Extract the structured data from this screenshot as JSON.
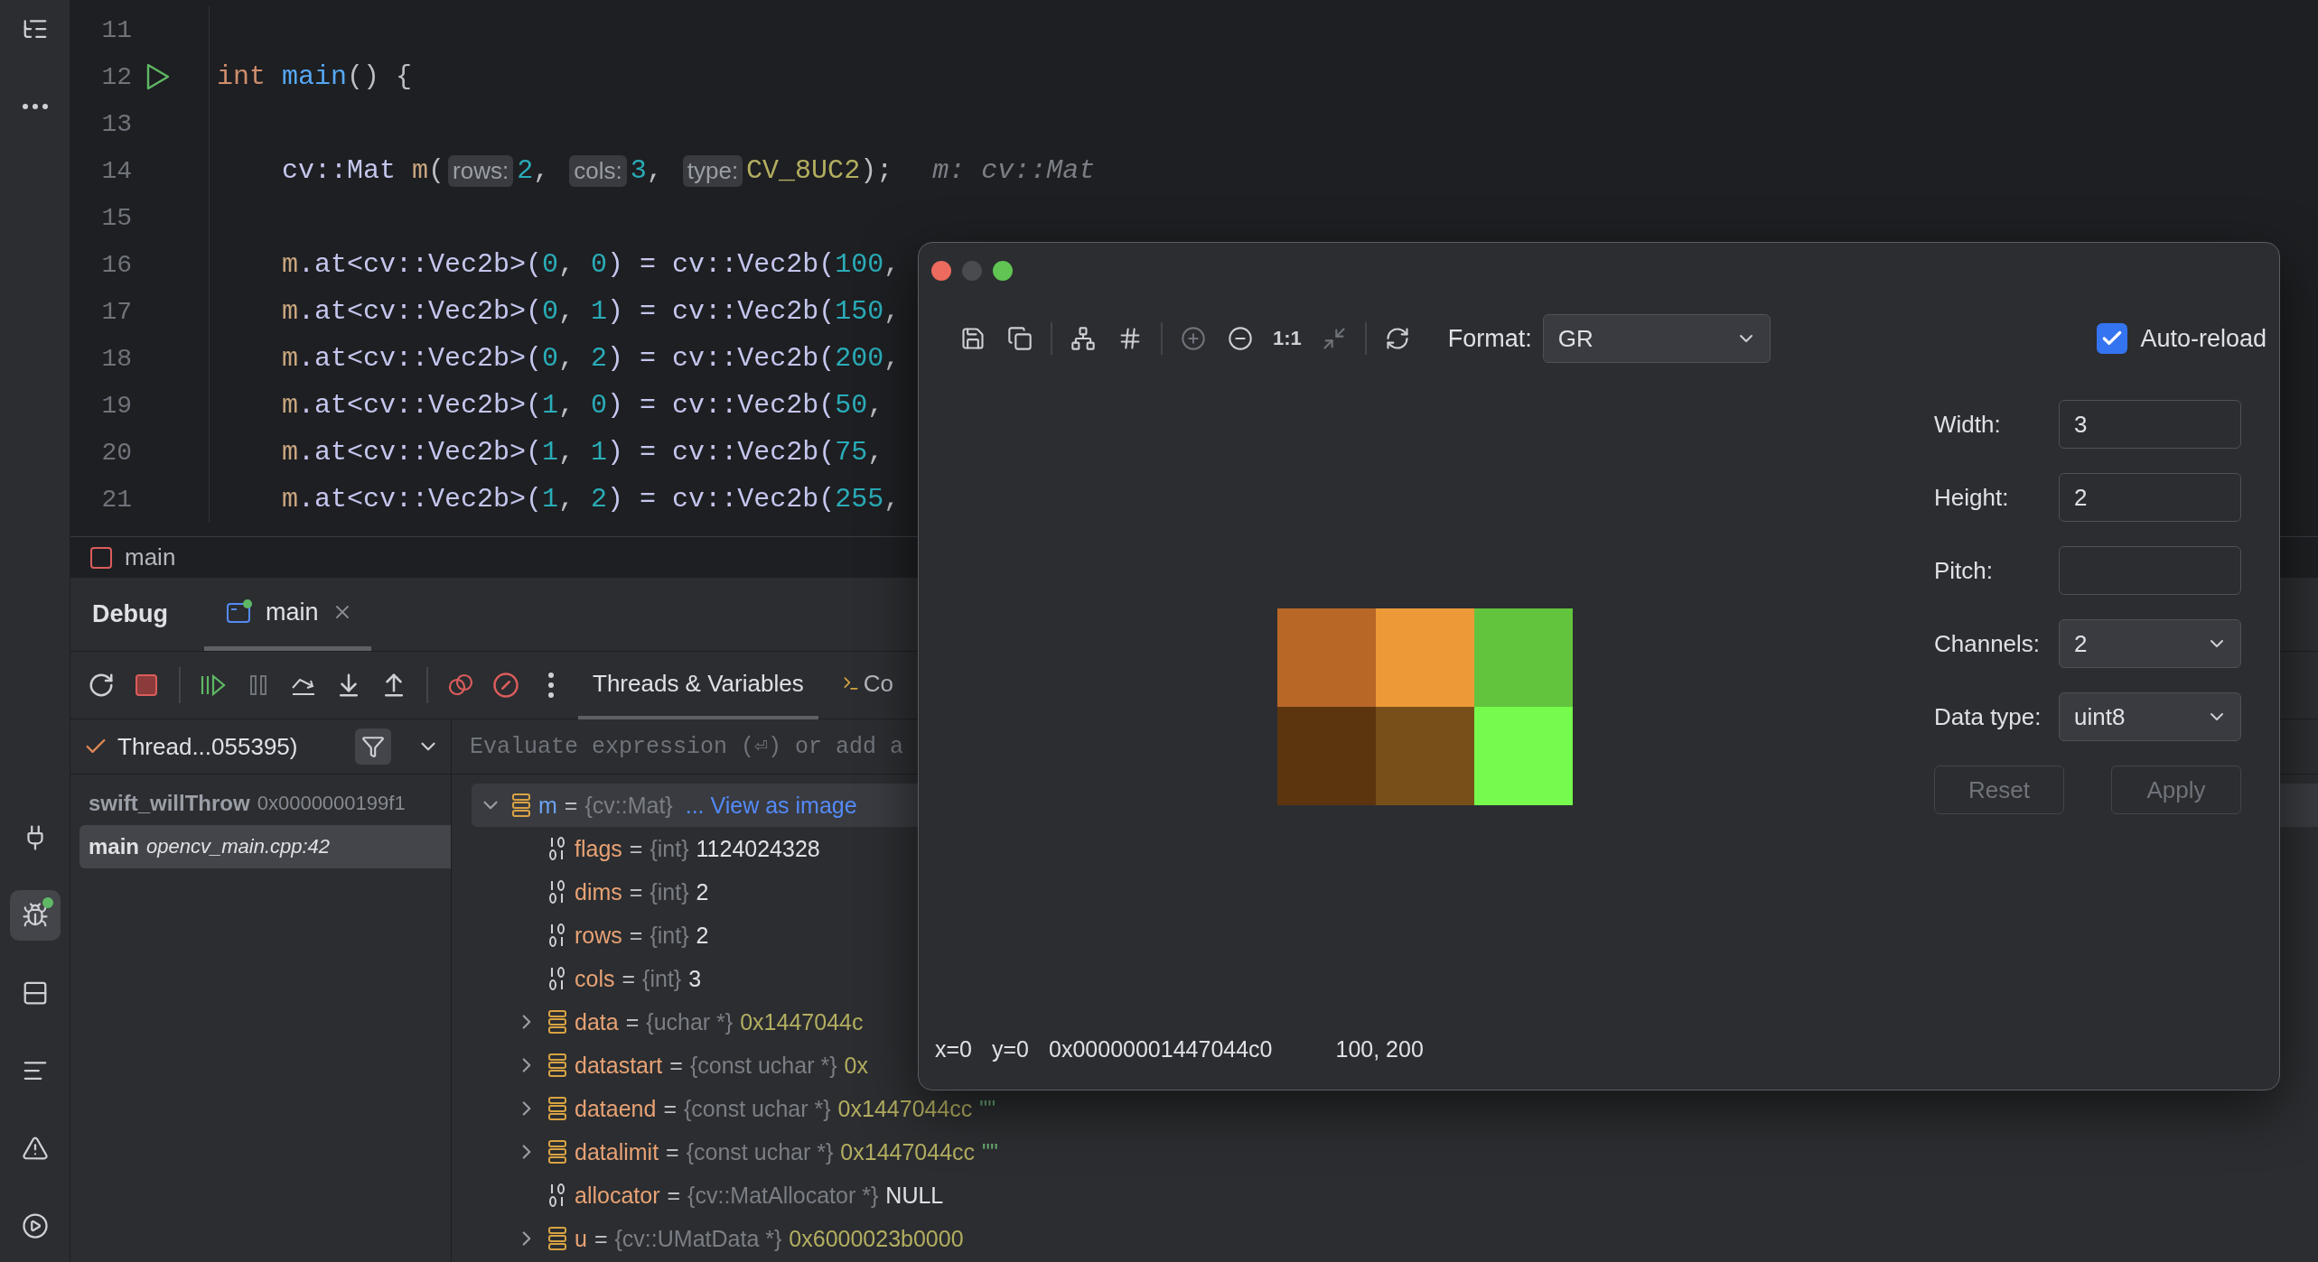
{
  "sidebar": {
    "top": [
      {
        "kind": "structure",
        "selected": false
      },
      {
        "kind": "more",
        "selected": false
      }
    ],
    "bottom": [
      {
        "kind": "plugin",
        "selected": false
      },
      {
        "kind": "debug",
        "selected": true
      },
      {
        "kind": "services",
        "selected": false
      },
      {
        "kind": "log",
        "selected": false
      },
      {
        "kind": "problems",
        "selected": false
      },
      {
        "kind": "run",
        "selected": false
      }
    ]
  },
  "editor": {
    "lines": [
      {
        "number": "11",
        "run": false
      },
      {
        "number": "12",
        "run": true,
        "tokens": [
          {
            "text": "int ",
            "kind": "keyword"
          },
          {
            "text": "main",
            "kind": "function"
          },
          {
            "text": "() {",
            "kind": "plain"
          }
        ]
      },
      {
        "number": "13",
        "run": false
      },
      {
        "number": "14",
        "run": false,
        "tokens": [
          {
            "text": "    cv::Mat ",
            "kind": "type"
          },
          {
            "text": "m",
            "kind": "variable"
          },
          {
            "text": "(",
            "kind": "plain"
          },
          {
            "text": "rows:",
            "kind": "hint"
          },
          {
            "text": "2",
            "kind": "number"
          },
          {
            "text": ", ",
            "kind": "plain"
          },
          {
            "text": "cols:",
            "kind": "hint"
          },
          {
            "text": "3",
            "kind": "number"
          },
          {
            "text": ", ",
            "kind": "plain"
          },
          {
            "text": "type:",
            "kind": "hint"
          },
          {
            "text": "CV_8UC2",
            "kind": "constant"
          },
          {
            "text": ");",
            "kind": "plain"
          },
          {
            "text": "m: cv::Mat",
            "kind": "annotation"
          }
        ]
      },
      {
        "number": "15",
        "run": false
      },
      {
        "number": "16",
        "run": false,
        "tokens": [
          {
            "text": "    m",
            "kind": "variable"
          },
          {
            "text": ".at<cv::Vec2b>(",
            "kind": "type"
          },
          {
            "text": "0",
            "kind": "number"
          },
          {
            "text": ", ",
            "kind": "plain"
          },
          {
            "text": "0",
            "kind": "number"
          },
          {
            "text": ") = cv::Vec2b(",
            "kind": "type"
          },
          {
            "text": "100",
            "kind": "number"
          },
          {
            "text": ",",
            "kind": "plain"
          }
        ]
      },
      {
        "number": "17",
        "run": false,
        "tokens": [
          {
            "text": "    m",
            "kind": "variable"
          },
          {
            "text": ".at<cv::Vec2b>(",
            "kind": "type"
          },
          {
            "text": "0",
            "kind": "number"
          },
          {
            "text": ", ",
            "kind": "plain"
          },
          {
            "text": "1",
            "kind": "number"
          },
          {
            "text": ") = cv::Vec2b(",
            "kind": "type"
          },
          {
            "text": "150",
            "kind": "number"
          },
          {
            "text": ",",
            "kind": "plain"
          }
        ]
      },
      {
        "number": "18",
        "run": false,
        "tokens": [
          {
            "text": "    m",
            "kind": "variable"
          },
          {
            "text": ".at<cv::Vec2b>(",
            "kind": "type"
          },
          {
            "text": "0",
            "kind": "number"
          },
          {
            "text": ", ",
            "kind": "plain"
          },
          {
            "text": "2",
            "kind": "number"
          },
          {
            "text": ") = cv::Vec2b(",
            "kind": "type"
          },
          {
            "text": "200",
            "kind": "number"
          },
          {
            "text": ",",
            "kind": "plain"
          }
        ]
      },
      {
        "number": "19",
        "run": false,
        "tokens": [
          {
            "text": "    m",
            "kind": "variable"
          },
          {
            "text": ".at<cv::Vec2b>(",
            "kind": "type"
          },
          {
            "text": "1",
            "kind": "number"
          },
          {
            "text": ", ",
            "kind": "plain"
          },
          {
            "text": "0",
            "kind": "number"
          },
          {
            "text": ") = cv::Vec2b(",
            "kind": "type"
          },
          {
            "text": "50",
            "kind": "number"
          },
          {
            "text": ",",
            "kind": "plain"
          }
        ]
      },
      {
        "number": "20",
        "run": false,
        "tokens": [
          {
            "text": "    m",
            "kind": "variable"
          },
          {
            "text": ".at<cv::Vec2b>(",
            "kind": "type"
          },
          {
            "text": "1",
            "kind": "number"
          },
          {
            "text": ", ",
            "kind": "plain"
          },
          {
            "text": "1",
            "kind": "number"
          },
          {
            "text": ") = cv::Vec2b(",
            "kind": "type"
          },
          {
            "text": "75",
            "kind": "number"
          },
          {
            "text": ",",
            "kind": "plain"
          }
        ]
      },
      {
        "number": "21",
        "run": false,
        "tokens": [
          {
            "text": "    m",
            "kind": "variable"
          },
          {
            "text": ".at<cv::Vec2b>(",
            "kind": "type"
          },
          {
            "text": "1",
            "kind": "number"
          },
          {
            "text": ", ",
            "kind": "plain"
          },
          {
            "text": "2",
            "kind": "number"
          },
          {
            "text": ") = cv::Vec2b(",
            "kind": "type"
          },
          {
            "text": "255",
            "kind": "number"
          },
          {
            "text": ",",
            "kind": "plain"
          }
        ]
      }
    ]
  },
  "breadcrumb": {
    "label": "main"
  },
  "debug": {
    "title": "Debug",
    "tabs": [
      {
        "label": "main",
        "selected": true
      }
    ],
    "toolbar": [
      {
        "kind": "rerun",
        "disabled": false
      },
      {
        "kind": "stop",
        "disabled": false
      },
      {
        "kind": "separator"
      },
      {
        "kind": "resume",
        "disabled": false
      },
      {
        "kind": "pause",
        "disabled": true
      },
      {
        "kind": "step_over",
        "disabled": false
      },
      {
        "kind": "step_into",
        "disabled": false
      },
      {
        "kind": "step_out",
        "disabled": false
      },
      {
        "kind": "separator"
      },
      {
        "kind": "breakpoints",
        "disabled": false
      },
      {
        "kind": "mute_breakpoints",
        "disabled": false
      },
      {
        "kind": "more",
        "disabled": false
      }
    ],
    "view_tabs": [
      {
        "label": "Threads & Variables",
        "kind": "variables",
        "selected": true
      },
      {
        "label": "Co",
        "kind": "console",
        "selected": false
      }
    ],
    "thread": {
      "label": "Thread...055395)"
    },
    "frames": [
      {
        "name": "swift_willThrow",
        "location": "0x0000000199f1",
        "kind": "address",
        "selected": false
      },
      {
        "name": "main",
        "location": "opencv_main.cpp:42",
        "kind": "source",
        "selected": true
      }
    ],
    "evaluate": {
      "placeholder": "Evaluate expression (⏎) or add a"
    },
    "variables": [
      {
        "kind": "object",
        "name": "m",
        "operator": "=",
        "type": "{cv::Mat}",
        "link": "... View as image",
        "expanded": true,
        "selected": true,
        "children": [
          {
            "kind": "primitive",
            "name": "flags",
            "operator": "=",
            "type": "{int}",
            "value": "1124024328",
            "selected": false
          },
          {
            "kind": "primitive",
            "name": "dims",
            "operator": "=",
            "type": "{int}",
            "value": "2",
            "selected": false
          },
          {
            "kind": "primitive",
            "name": "rows",
            "operator": "=",
            "type": "{int}",
            "value": "2",
            "selected": false
          },
          {
            "kind": "primitive",
            "name": "cols",
            "operator": "=",
            "type": "{int}",
            "value": "3",
            "selected": false
          },
          {
            "kind": "object",
            "name": "data",
            "operator": "=",
            "type": "{uchar *}",
            "value": "0x1447044c",
            "expanded": false,
            "selected": false
          },
          {
            "kind": "object",
            "name": "datastart",
            "operator": "=",
            "type": "{const uchar *}",
            "value": "0x",
            "expanded": false,
            "selected": false
          },
          {
            "kind": "object",
            "name": "dataend",
            "operator": "=",
            "type": "{const uchar *}",
            "value": "0x1447044cc",
            "suffix": "\"\"",
            "expanded": false,
            "selected": false
          },
          {
            "kind": "object",
            "name": "datalimit",
            "operator": "=",
            "type": "{const uchar *}",
            "value": "0x1447044cc",
            "suffix": "\"\"",
            "expanded": false,
            "selected": false
          },
          {
            "kind": "primitive",
            "name": "allocator",
            "operator": "=",
            "type": "{cv::MatAllocator *}",
            "value": "NULL",
            "selected": false
          },
          {
            "kind": "object",
            "name": "u",
            "operator": "=",
            "type": "{cv::UMatData *}",
            "value": "0x6000023b0000",
            "expanded": false,
            "selected": false
          }
        ]
      }
    ]
  },
  "image_viewer": {
    "toolbar": [
      {
        "kind": "save",
        "disabled": false
      },
      {
        "kind": "copy",
        "disabled": false
      },
      {
        "kind": "separator"
      },
      {
        "kind": "fit",
        "disabled": false
      },
      {
        "kind": "crop",
        "disabled": false
      },
      {
        "kind": "separator"
      },
      {
        "kind": "zoom_in",
        "disabled": true
      },
      {
        "kind": "zoom_out",
        "disabled": false
      },
      {
        "kind": "actual_size",
        "label": "1:1",
        "disabled": false
      },
      {
        "kind": "fit_window",
        "disabled": true
      },
      {
        "kind": "separator"
      },
      {
        "kind": "reload",
        "disabled": false
      }
    ],
    "format": {
      "label": "Format:",
      "value": "GR"
    },
    "auto_reload": {
      "label": "Auto-reload",
      "checked": true
    },
    "pixels": [
      [
        {
          "color": "#b86727"
        },
        {
          "color": "#ec9a37"
        },
        {
          "color": "#62c43c"
        }
      ],
      [
        {
          "color": "#5c350f"
        },
        {
          "color": "#784f19"
        },
        {
          "color": "#76fa4d"
        }
      ]
    ],
    "fields": [
      {
        "kind": "input",
        "label": "Width:",
        "value": "3"
      },
      {
        "kind": "input",
        "label": "Height:",
        "value": "2"
      },
      {
        "kind": "input",
        "label": "Pitch:"
      },
      {
        "kind": "select",
        "label": "Channels:",
        "value": "2"
      },
      {
        "kind": "select",
        "label": "Data type:",
        "value": "uint8"
      }
    ],
    "buttons": [
      {
        "label": "Reset",
        "disabled": true
      },
      {
        "label": "Apply",
        "disabled": true
      }
    ],
    "status": [
      {
        "text": "x=0",
        "kind": "coord"
      },
      {
        "text": "y=0",
        "kind": "coord"
      },
      {
        "text": "0x00000001447044c0",
        "kind": "address"
      },
      {
        "text": "100, 200",
        "kind": "value"
      }
    ]
  }
}
